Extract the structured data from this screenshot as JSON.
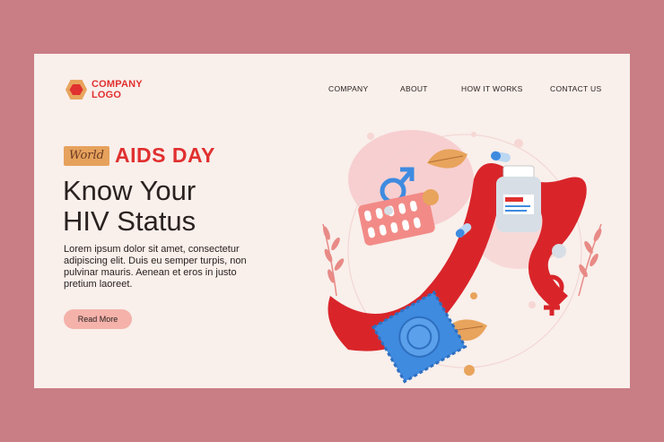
{
  "brand": {
    "line1": "COMPANY",
    "line2": "LOGO",
    "color": "#e0302f",
    "icon": "hexagon-icon"
  },
  "nav": {
    "items": [
      {
        "label": "COMPANY"
      },
      {
        "label": "ABOUT"
      },
      {
        "label": "HOW IT WORKS"
      },
      {
        "label": "CONTACT US"
      }
    ]
  },
  "hero": {
    "badge": "World",
    "event": "AIDS DAY",
    "title_line1": "Know Your",
    "title_line2": "HIV Status",
    "body": "Lorem ipsum dolor sit amet, consectetur adipiscing elit. Duis eu semper turpis, non pulvinar mauris. Aenean et eros in justo pretium laoreet.",
    "cta_label": "Read More"
  },
  "colors": {
    "background": "#c97d84",
    "page": "#f9efeb",
    "accent": "#e0302f",
    "badge": "#e6a25c",
    "button": "#f4b2aa",
    "ribbon": "#d9252a",
    "blue": "#3f8be0"
  },
  "illustration": {
    "icons": [
      "red-ribbon-icon",
      "pill-bottle-icon",
      "pill-blister-icon",
      "condom-packet-icon",
      "male-symbol-icon",
      "female-symbol-icon",
      "leaf-icon",
      "capsule-icon"
    ]
  }
}
